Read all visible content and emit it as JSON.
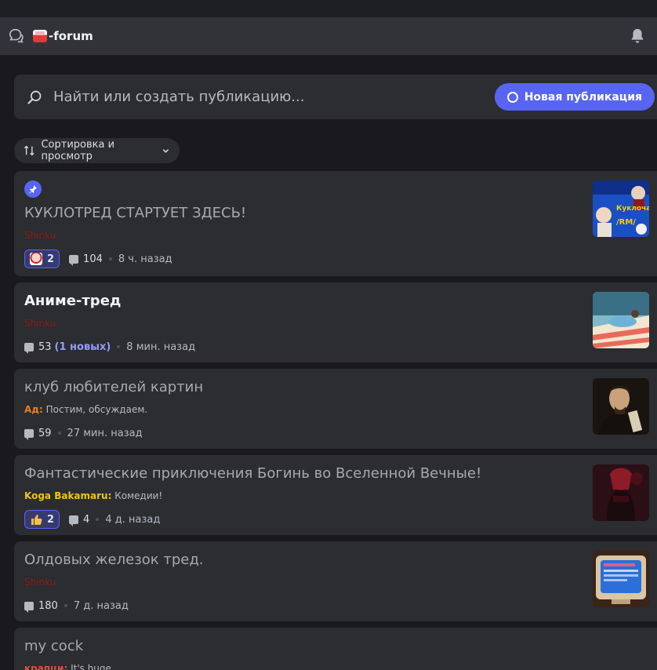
{
  "header": {
    "channel_name": "-forum"
  },
  "search": {
    "placeholder": "Найти или создать публикацию...",
    "new_post_label": "Новая публикация"
  },
  "sort": {
    "label": "Сортировка и просмотр"
  },
  "posts": [
    {
      "title": "КУКЛОТРЕД СТАРТУЕТ ЗДЕСЬ!",
      "author": "Shinku",
      "author_color": "#8b1a1a",
      "preview": "",
      "reaction_count": "2",
      "messages": "104",
      "new": "",
      "time": "8 ч. назад",
      "pinned": true,
      "thumb": "art-doll"
    },
    {
      "title": "Аниме-тред",
      "author": "Shinku",
      "author_color": "#8b1a1a",
      "preview": "",
      "reaction_count": "",
      "messages": "53",
      "new": "(1 новых)",
      "time": "8 мин. назад",
      "thumb": "anime-beach"
    },
    {
      "title": "клуб любителей картин",
      "author": "Ад",
      "author_color": "#e67e22",
      "preview": "Постим, обсуждаем.",
      "reaction_count": "",
      "messages": "59",
      "new": "",
      "time": "27 мин. назад",
      "thumb": "painting-portrait"
    },
    {
      "title": "Фантастические приключения Богинь во Вселенной Вечные!",
      "author": "Koga Bakamaru",
      "author_color": "#f1c40f",
      "preview": "Комедии!",
      "reaction_count": "2",
      "reaction_emoji": "thumbs-up",
      "messages": "4",
      "new": "",
      "time": "4 д. назад",
      "thumb": "anime-girl-red"
    },
    {
      "title": "Олдовых железок тред.",
      "author": "Shinku",
      "author_color": "#8b1a1a",
      "preview": "",
      "reaction_count": "",
      "messages": "180",
      "new": "",
      "time": "7 д. назад",
      "thumb": "retro-monitor"
    },
    {
      "title": "my cock",
      "author": "крапци",
      "author_color": "#e74c3c",
      "preview": "It's huge",
      "reaction_count": "",
      "messages": "",
      "new": "",
      "time": ""
    }
  ],
  "colors": {
    "accent": "#5865f2",
    "bg": "#1a1a1e",
    "card": "#2b2d31"
  }
}
